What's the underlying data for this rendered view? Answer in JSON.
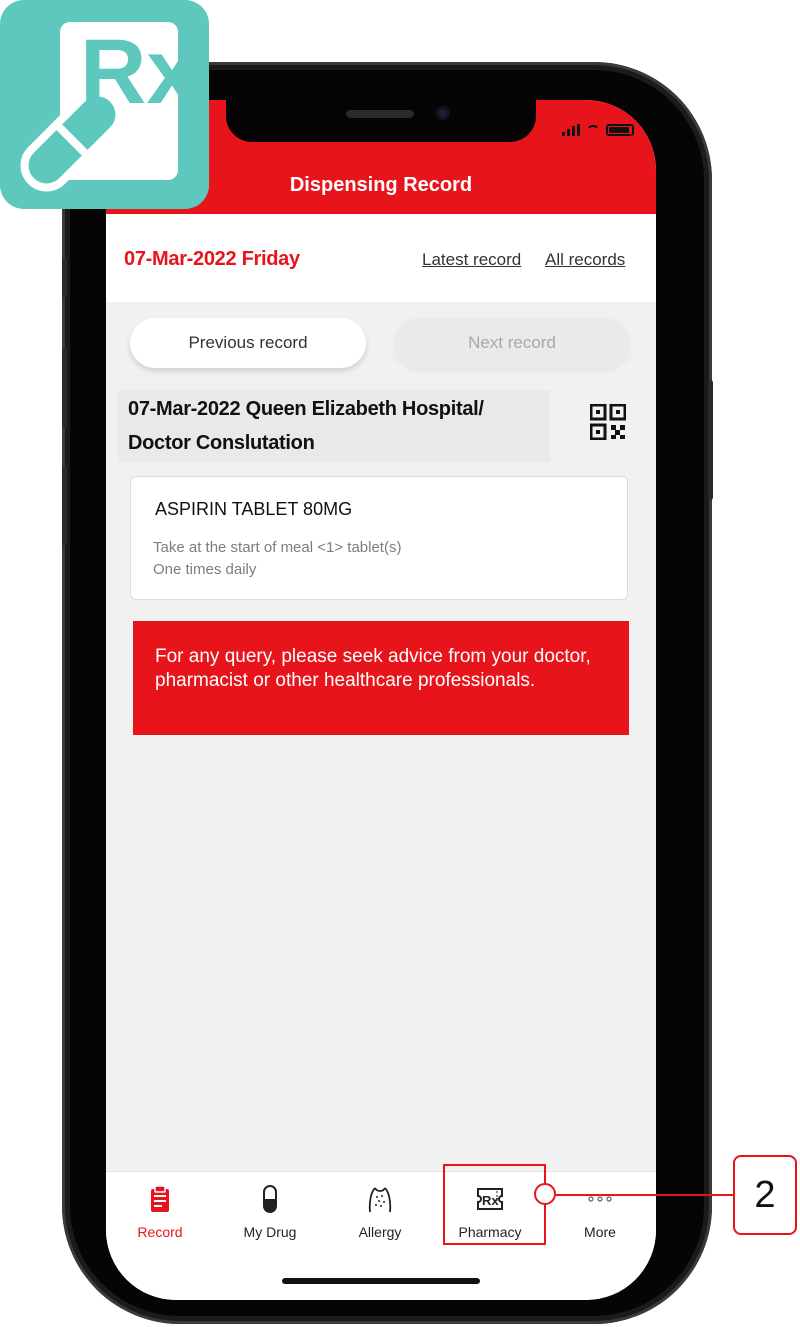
{
  "header": {
    "title": "Dispensing Record"
  },
  "date_bar": {
    "date": "07-Mar-2022 Friday",
    "latest_link": "Latest record",
    "all_link": "All records"
  },
  "nav_buttons": {
    "previous": "Previous record",
    "next": "Next record"
  },
  "record": {
    "line1": "07-Mar-2022  Queen Elizabeth Hospital/",
    "line2": "Doctor Conslutation"
  },
  "drug": {
    "name": "ASPIRIN TABLET 80MG",
    "instruction": "Take at the start of meal <1> tablet(s)",
    "frequency": "One times daily"
  },
  "notice": "For any query, please seek advice from your doctor, pharmacist or other healthcare professionals.",
  "tabs": [
    {
      "label": "Record",
      "icon": "clipboard-icon",
      "active": true
    },
    {
      "label": "My Drug",
      "icon": "capsule-icon",
      "active": false
    },
    {
      "label": "Allergy",
      "icon": "allergy-icon",
      "active": false
    },
    {
      "label": "Pharmacy",
      "icon": "rx-ticket-icon",
      "active": false
    },
    {
      "label": "More",
      "icon": "more-dots-icon",
      "active": false
    }
  ],
  "callout": {
    "number": "2"
  },
  "colors": {
    "accent": "#e8141c",
    "logo": "#5ec8bf"
  },
  "logo": {
    "text": "Rx"
  }
}
